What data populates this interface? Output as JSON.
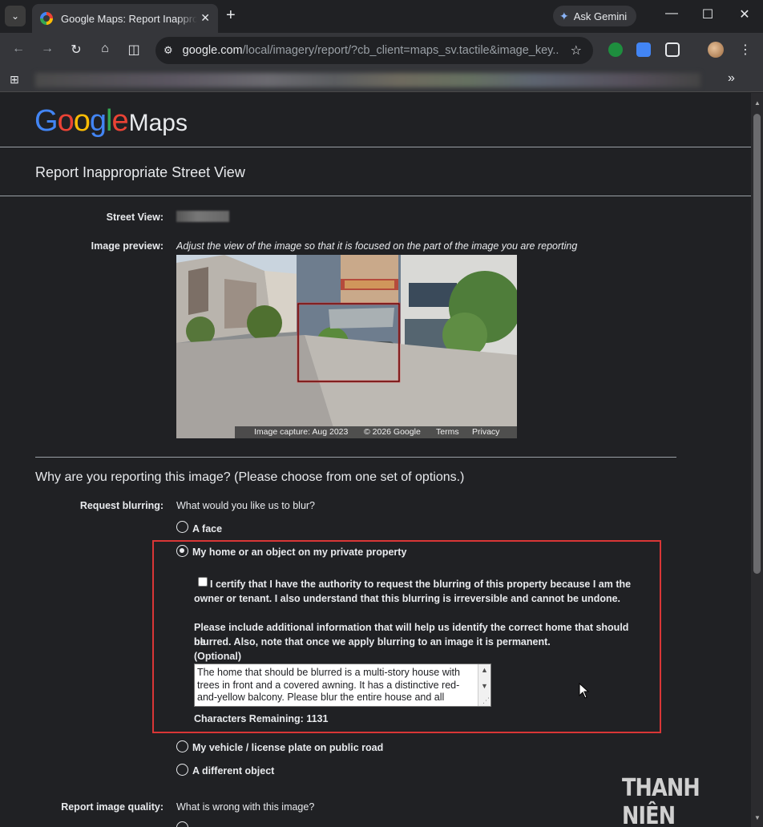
{
  "browser": {
    "tab_title": "Google Maps: Report Inappropriate Street View",
    "gemini_label": "Ask Gemini",
    "url_domain": "google.com",
    "url_path": "/local/imagery/report/?cb_client=maps_sv.tactile&image_key..."
  },
  "logo": {
    "google_letters": [
      "G",
      "o",
      "o",
      "g",
      "l",
      "e"
    ],
    "maps_text": "Maps"
  },
  "page": {
    "title": "Report Inappropriate Street View",
    "street_view_label": "Street View:",
    "image_preview_label": "Image preview:",
    "image_preview_instruction": "Adjust the view of the image so that it is focused on the part of the image you are reporting",
    "preview_footer": {
      "capture": "Image capture: Aug 2023",
      "copyright": "© 2026 Google",
      "terms": "Terms",
      "privacy": "Privacy"
    },
    "question": "Why are you reporting this image?  (Please choose from one set of options.)",
    "request_blurring_label": "Request blurring:",
    "blur_question": "What would you like us to blur?",
    "options": {
      "face": "A face",
      "home": "My home or an object on my private property",
      "vehicle": "My vehicle / license plate on public road",
      "other": "A different object"
    },
    "certify_line1": "I certify that I have the authority to request the blurring of this property because I am the",
    "certify_line2": "owner or tenant. I also understand that this blurring is irreversible and cannot be undone.",
    "info_line1": "Please include additional information that will help us identify the correct home that should be",
    "info_line2": "blurred. Also, note that once we apply blurring to an image it is permanent.",
    "optional_label": "(Optional)",
    "textarea_value": "The home that should be blurred is a multi-story house with trees in front and a covered awning. It has a distinctive red-and-yellow balcony. Please blur the entire house and all",
    "characters_remaining": "Characters Remaining: 1131",
    "report_quality_label": "Report image quality:",
    "quality_question": "What is wrong with this image?"
  },
  "watermark": "THANH NIÊN",
  "colors": {
    "background": "#202124",
    "highlight_border": "#d93636",
    "google_blue": "#4285f4",
    "google_red": "#ea4335",
    "google_yellow": "#fbbc05",
    "google_green": "#34a853"
  }
}
